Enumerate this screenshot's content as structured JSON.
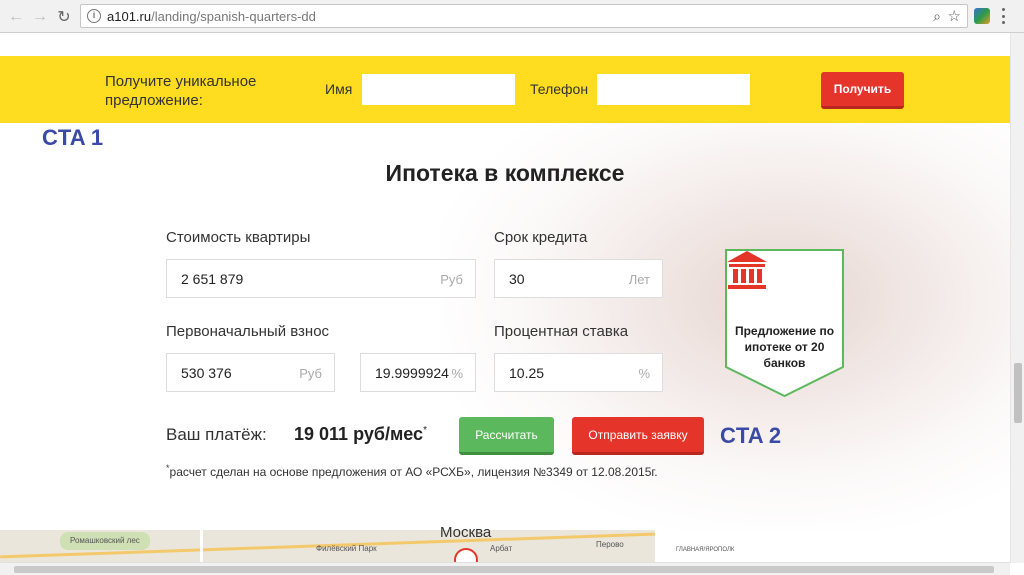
{
  "browser": {
    "url_host": "a101.ru",
    "url_path": "/landing/spanish-quarters-dd"
  },
  "yellow_bar": {
    "label": "Получите уникальное предложение:",
    "name_label": "Имя",
    "name_value": "",
    "phone_label": "Телефон",
    "phone_value": "",
    "submit_label": "Получить",
    "color": "#fedc1f"
  },
  "annotations": {
    "cta1": "CTA 1",
    "cta2": "CTA 2"
  },
  "calculator": {
    "title": "Ипотека в комплексе",
    "price_label": "Стоимость квартиры",
    "price_value": "2 651 879",
    "price_unit": "Руб",
    "term_label": "Срок кредита",
    "term_value": "30",
    "term_unit": "Лет",
    "down_label": "Первоначальный взнос",
    "down_value": "530 376",
    "down_unit": "Руб",
    "down_percent_value": "19.9999924",
    "down_percent_unit": "%",
    "rate_label": "Процентная ставка",
    "rate_value": "10.25",
    "rate_unit": "%",
    "payment_label": "Ваш платёж:",
    "payment_value": "19 011 руб/мес",
    "payment_mark": "*",
    "calc_button": "Рассчитать",
    "request_button": "Отправить заявку",
    "footnote_mark": "*",
    "footnote": "расчет сделан на основе предложения от АО «РСХБ», лицензия №3349 от 12.08.2015г."
  },
  "badge": {
    "icon": "bank-icon",
    "text": "Предложение по ипотеке от 20 банков",
    "border_color": "#5cb85c",
    "icon_color": "#e5352b"
  },
  "map": {
    "city": "Москва",
    "labels": [
      "Ромашковский лес",
      "Филёвский Парк",
      "Арбат",
      "Перово",
      "ГЛАВНАЯ/ЯРОПОЛК"
    ]
  },
  "colors": {
    "accent_red": "#e5352b",
    "accent_green": "#5cb85c",
    "annotation_blue": "#3b4aa6"
  }
}
